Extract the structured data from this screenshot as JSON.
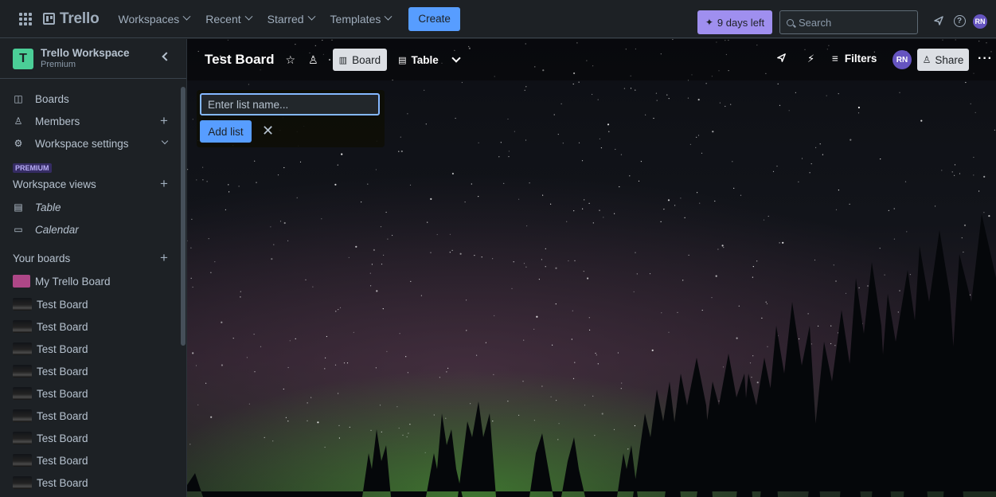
{
  "topbar": {
    "apps_icon": "grid-icon",
    "logo": "Trello",
    "nav": [
      "Workspaces",
      "Recent",
      "Starred",
      "Templates"
    ],
    "create_label": "Create",
    "trial_label": "9 days left",
    "search_placeholder": "Search",
    "avatar_initials": "RN"
  },
  "sidebar": {
    "workspace_initial": "T",
    "workspace_name": "Trello Workspace",
    "workspace_plan": "Premium",
    "items": [
      {
        "label": "Boards",
        "icon": "board-icon"
      },
      {
        "label": "Members",
        "icon": "person-icon"
      },
      {
        "label": "Workspace settings",
        "icon": "gear-icon"
      }
    ],
    "premium_badge": "PREMIUM",
    "views_heading": "Workspace views",
    "views": [
      {
        "label": "Table",
        "icon": "table-icon"
      },
      {
        "label": "Calendar",
        "icon": "calendar-icon"
      }
    ],
    "boards_heading": "Your boards",
    "boards": [
      "My Trello Board",
      "Test Board",
      "Test Board",
      "Test Board",
      "Test Board",
      "Test Board",
      "Test Board",
      "Test Board",
      "Test Board",
      "Test Board"
    ]
  },
  "board": {
    "title": "Test Board",
    "views": [
      "Board",
      "Table"
    ],
    "filters_label": "Filters",
    "avatar_initials": "RN",
    "share_label": "Share",
    "more_label": "···",
    "add_list": {
      "placeholder": "Enter list name...",
      "button_label": "Add list",
      "close_label": "✕"
    }
  },
  "colors": {
    "create": "#579dff",
    "trial": "#9f8fef",
    "workspace_logo": "#4bce97",
    "avatar": "#6554c0",
    "pink_board": "#ae4787"
  }
}
